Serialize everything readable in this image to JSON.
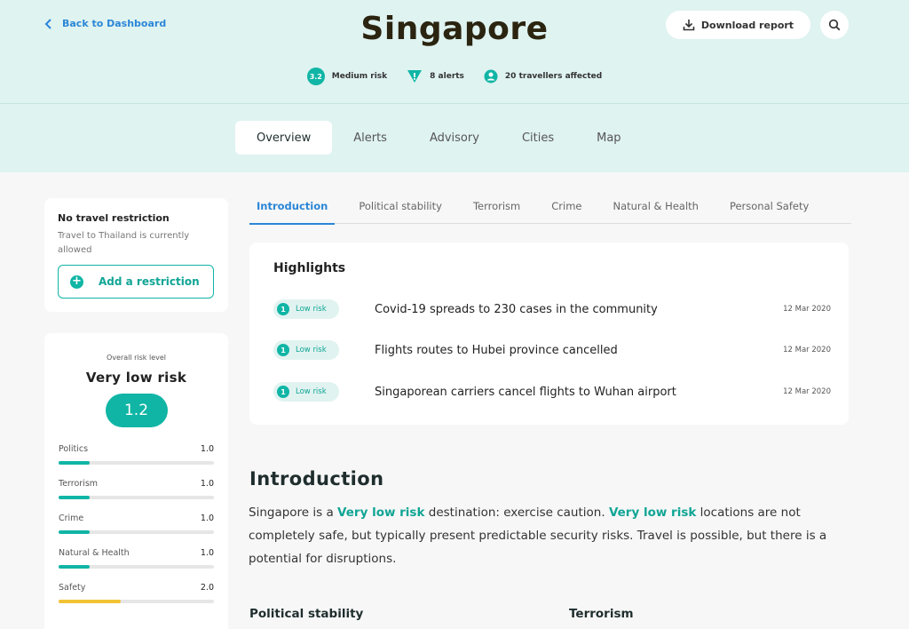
{
  "header": {
    "back_label": "Back to Dashboard",
    "title": "Singapore",
    "download_label": "Download report",
    "stats": {
      "score": "3.2",
      "risk": "Medium risk",
      "alerts": "8 alerts",
      "travellers": "20 travellers affected"
    }
  },
  "tabs": [
    "Overview",
    "Alerts",
    "Advisory",
    "Cities",
    "Map"
  ],
  "restriction": {
    "title": "No travel restriction",
    "text": "Travel to Thailand is currently allowed",
    "button": "Add a restriction"
  },
  "risk": {
    "label": "Overall risk level",
    "level": "Very low risk",
    "score": "1.2",
    "categories": [
      {
        "name": "Politics",
        "value": "1.0",
        "level": 0.2,
        "color": "#10b5a5"
      },
      {
        "name": "Terrorism",
        "value": "1.0",
        "level": 0.2,
        "color": "#10b5a5"
      },
      {
        "name": "Crime",
        "value": "1.0",
        "level": 0.2,
        "color": "#10b5a5"
      },
      {
        "name": "Natural & Health",
        "value": "1.0",
        "level": 0.2,
        "color": "#10b5a5"
      },
      {
        "name": "Safety",
        "value": "2.0",
        "level": 0.4,
        "color": "#f2c335"
      }
    ]
  },
  "subtabs": [
    "Introduction",
    "Political stability",
    "Terrorism",
    "Crime",
    "Natural & Health",
    "Personal Safety"
  ],
  "highlights": {
    "title": "Highlights",
    "items": [
      {
        "level": "1",
        "badge": "Low risk",
        "text": "Covid-19 spreads to 230 cases in the community",
        "date": "12 Mar 2020"
      },
      {
        "level": "1",
        "badge": "Low risk",
        "text": "Flights routes to Hubei province cancelled",
        "date": "12 Mar 2020"
      },
      {
        "level": "1",
        "badge": "Low risk",
        "text": "Singaporean carriers cancel flights to Wuhan airport",
        "date": "12 Mar 2020"
      }
    ]
  },
  "intro": {
    "heading": "Introduction",
    "country": "Singapore",
    "p1": " is a ",
    "hl1": "Very low risk",
    "p2": " destination: exercise caution. ",
    "hl2": "Very low risk",
    "p3": " locations are not completely safe, but typically present predictable security risks. Travel is possible, but there is a potential for disruptions."
  },
  "sections": {
    "political": "Political stability",
    "terrorism": "Terrorism"
  },
  "colors": {
    "accent": "#10b5a5",
    "link": "#2b86d6",
    "header_bg": "#dff3f1",
    "warning": "#f2c335"
  }
}
